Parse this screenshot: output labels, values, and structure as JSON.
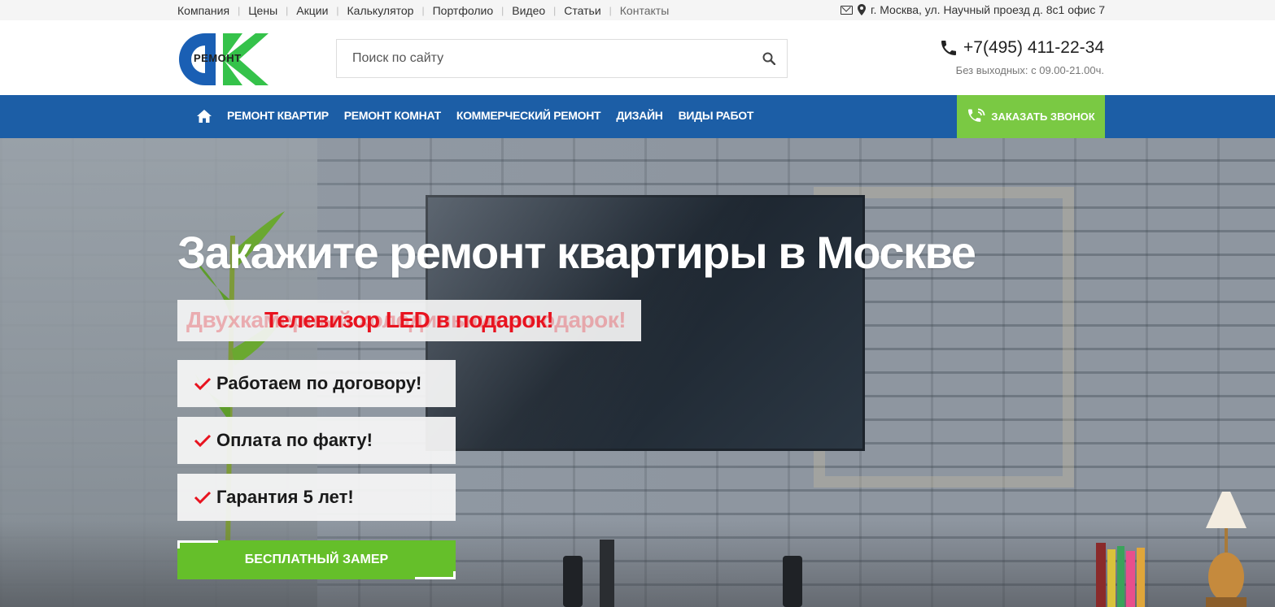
{
  "topbar": {
    "nav": [
      "Компания",
      "Цены",
      "Акции",
      "Калькулятор",
      "Портфолио",
      "Видео",
      "Статьи",
      "Контакты"
    ],
    "address": "г. Москва, ул. Научный проезд д. 8с1 офис 7",
    "icons": [
      "mail-icon",
      "map-pin-icon"
    ]
  },
  "header": {
    "logo_text": "РЕМОНТ",
    "search_placeholder": "Поиск по сайту",
    "phone": "+7(495) 411-22-34",
    "hours": "Без выходных: с 09.00-21.00ч."
  },
  "mainnav": {
    "items": [
      "РЕМОНТ КВАРТИР",
      "РЕМОНТ КОМНАТ",
      "КОММЕРЧЕСКИЙ РЕМОНТ",
      "ДИЗАЙН",
      "ВИДЫ РАБОТ"
    ],
    "callback_label": "ЗАКАЗАТЬ ЗВОНОК"
  },
  "hero": {
    "title": "Закажите ремонт квартиры в Москве",
    "promo_ghost": "Двухкамерный холодильник в подарок!",
    "promo": "Телевизор LED в подарок!",
    "features": [
      "Работаем по договору!",
      "Оплата по факту!",
      "Гарантия 5 лет!"
    ],
    "cta_label": "БЕСПЛАТНЫЙ ЗАМЕР"
  },
  "colors": {
    "nav_blue": "#1c5ea6",
    "green": "#7ac943",
    "cta_green": "#65bf2a",
    "promo_red": "#e8131f",
    "logo_blue": "#1a5fb4",
    "logo_green": "#35c24a"
  }
}
